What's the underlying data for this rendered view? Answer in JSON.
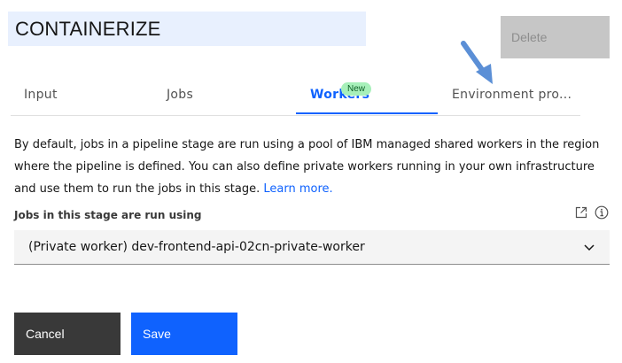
{
  "header": {
    "stage_name": "CONTAINERIZE",
    "delete_label": "Delete"
  },
  "tabs": [
    {
      "label": "Input",
      "selected": false
    },
    {
      "label": "Jobs",
      "selected": false
    },
    {
      "label": "Workers",
      "selected": true,
      "badge": "New"
    },
    {
      "label": "Environment pro...",
      "selected": false
    }
  ],
  "description": {
    "text": "By default, jobs in a pipeline stage are run using a pool of IBM managed shared workers in the region where the pipeline is defined. You can also define private workers running in your own infrastructure and use them to run the jobs in this stage.",
    "link_text": "Learn more."
  },
  "worker_field": {
    "label": "Jobs in this stage are run using",
    "value": "(Private worker) dev-frontend-api-02cn-private-worker",
    "icons": [
      "external-link-icon",
      "info-icon",
      "chevron-down-icon"
    ]
  },
  "footer": {
    "cancel_label": "Cancel",
    "save_label": "Save"
  },
  "colors": {
    "accent": "#0f62fe",
    "badge_bg": "#a7f0ba",
    "title_highlight": "#e8f0fe",
    "disabled_button": "#c6c6c6",
    "secondary_button": "#393939",
    "annotation_arrow": "#5b8fd6"
  }
}
